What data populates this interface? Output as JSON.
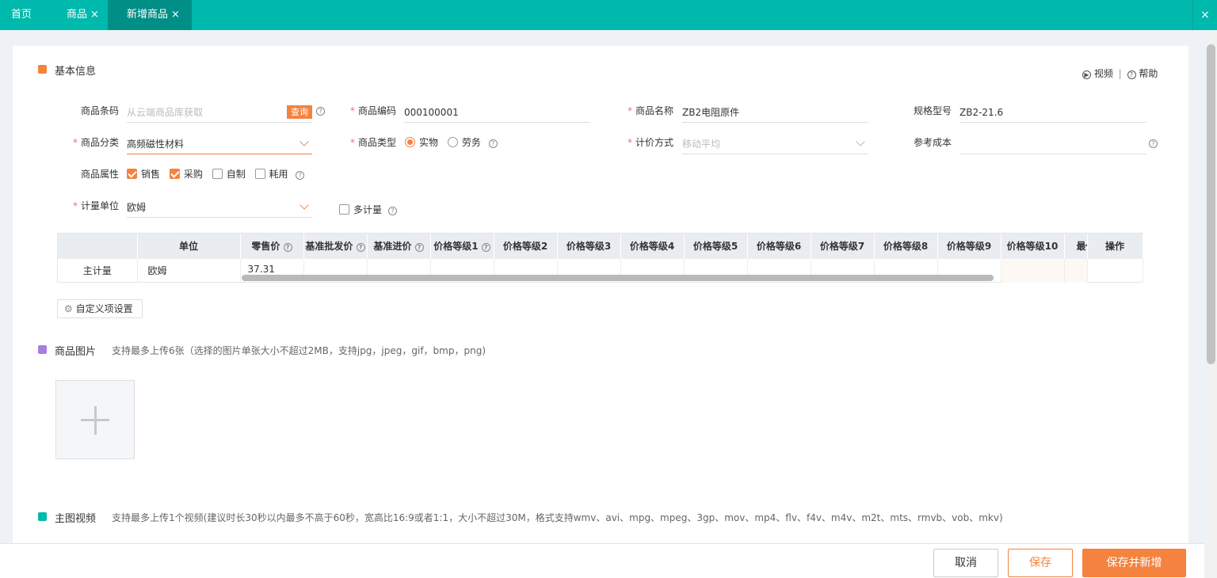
{
  "tabs": [
    {
      "label": "首页"
    },
    {
      "label": "商品",
      "close": "×"
    },
    {
      "label": "新增商品",
      "close": "×"
    }
  ],
  "close_all": "×",
  "basic": {
    "title": "基本信息",
    "video": "视频",
    "help": "帮助",
    "sep": "|"
  },
  "fields": {
    "barcode": {
      "label": "商品条码",
      "placeholder": "从云端商品库获取",
      "query": "查询"
    },
    "code": {
      "label": "商品编码",
      "value": "000100001"
    },
    "name": {
      "label": "商品名称",
      "value": "ZB2电阻原件"
    },
    "spec": {
      "label": "规格型号",
      "value": "ZB2-21.6"
    },
    "category": {
      "label": "商品分类",
      "value": "高频磁性材料"
    },
    "type": {
      "label": "商品类型",
      "opt1": "实物",
      "opt2": "劳务"
    },
    "pricing": {
      "label": "计价方式",
      "placeholder": "移动平均"
    },
    "cost": {
      "label": "参考成本"
    },
    "attr": {
      "label": "商品属性",
      "a1": "销售",
      "a2": "采购",
      "a3": "自制",
      "a4": "耗用"
    },
    "unit": {
      "label": "计量单位",
      "value": "欧姆"
    },
    "multi": {
      "label": "多计量"
    }
  },
  "grid": {
    "headers": [
      "单位",
      "零售价",
      "基准批发价",
      "基准进价",
      "价格等级1",
      "价格等级2",
      "价格等级3",
      "价格等级4",
      "价格等级5",
      "价格等级6",
      "价格等级7",
      "价格等级8",
      "价格等级9",
      "价格等级10",
      "最低",
      "操作"
    ],
    "row": {
      "kind": "主计量",
      "unit": "欧姆",
      "retail": "37.31"
    }
  },
  "custom_btn": "自定义项设置",
  "images": {
    "title": "商品图片",
    "desc": "支持最多上传6张（选择的图片单张大小不超过2MB，支持jpg，jpeg，gif，bmp，png)"
  },
  "video": {
    "title": "主图视频",
    "desc": "支持最多上传1个视频(建议时长30秒以内最多不高于60秒，宽高比16:9或者1:1，大小不超过30M，格式支持wmv、avi、mpg、mpeg、3gp、mov、mp4、flv、f4v、m4v、m2t、mts、rmvb、vob、mkv)"
  },
  "footer": {
    "cancel": "取消",
    "save": "保存",
    "save_new": "保存并新增"
  },
  "colors": {
    "teal": "#00b9ad",
    "orange": "#f5833f"
  }
}
